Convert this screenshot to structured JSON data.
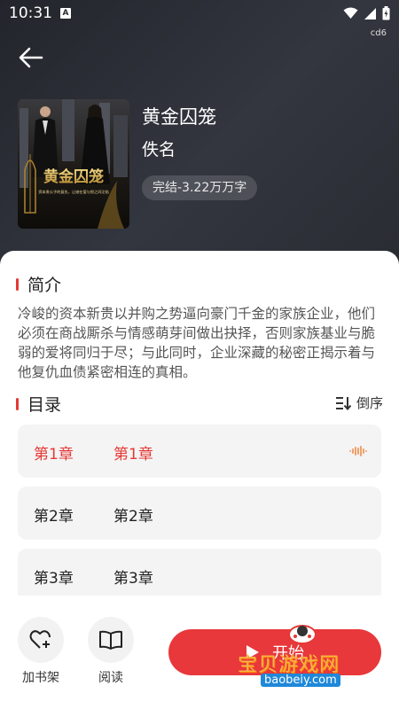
{
  "status_bar": {
    "time": "10:31",
    "badge": "A",
    "carrier": "cd6"
  },
  "book": {
    "title": "黄金囚笼",
    "author": "佚名",
    "status": "完结-3.22万万字",
    "cover_title": "黄金囚笼",
    "cover_subtitle": "资本贵公子的复仇，让她在爱与恨之间沦陷"
  },
  "intro": {
    "heading": "简介",
    "text": "冷峻的资本新贵以并购之势逼向豪门千金的家族企业，他们必须在商战厮杀与情感萌芽间做出抉择，否则家族基业与脆弱的爱将同归于尽；与此同时，企业深藏的秘密正揭示着与他复仇血债紧密相连的真相。"
  },
  "catalog": {
    "heading": "目录",
    "sort_label": "倒序",
    "chapters": [
      {
        "num": "第1章",
        "title": "第1章"
      },
      {
        "num": "第2章",
        "title": "第2章"
      },
      {
        "num": "第3章",
        "title": "第3章"
      }
    ]
  },
  "bottom": {
    "add_shelf": "加书架",
    "read": "阅读",
    "start": "开始"
  },
  "watermark": {
    "text": "宝贝游戏网",
    "url": "baobeiy.com"
  },
  "colors": {
    "accent": "#e53935",
    "hero_bg": "#2a2c33",
    "start_btn": "#e8383b"
  },
  "icons": [
    "back-arrow-icon",
    "wifi-icon",
    "signal-icon",
    "battery-icon",
    "sort-icon",
    "audio-wave-icon",
    "heart-plus-icon",
    "open-book-icon",
    "play-icon"
  ]
}
